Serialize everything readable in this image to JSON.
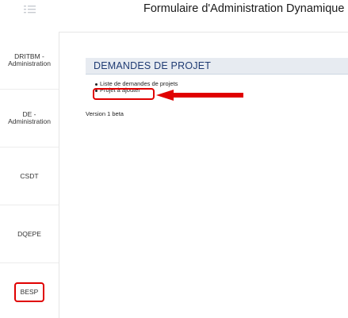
{
  "header": {
    "title": "Formulaire d'Administration Dynamique",
    "menu_icon": "hamburger-icon"
  },
  "sidebar": {
    "items": [
      {
        "line1": "DRITBM -",
        "line2": "Administration"
      },
      {
        "line1": "DE -",
        "line2": "Administration"
      },
      {
        "line1": "CSDT",
        "line2": ""
      },
      {
        "line1": "DQEPE",
        "line2": ""
      },
      {
        "line1": "BESP",
        "line2": ""
      }
    ]
  },
  "main": {
    "panel_title": "DEMANDES DE PROJET",
    "links": [
      "Liste de demandes de projets",
      "Projet à ajouter"
    ],
    "version": "Version 1 beta"
  },
  "colors": {
    "annotation_red": "#e00000",
    "panel_bg": "#e7ebf1",
    "panel_title": "#1f3b73"
  }
}
